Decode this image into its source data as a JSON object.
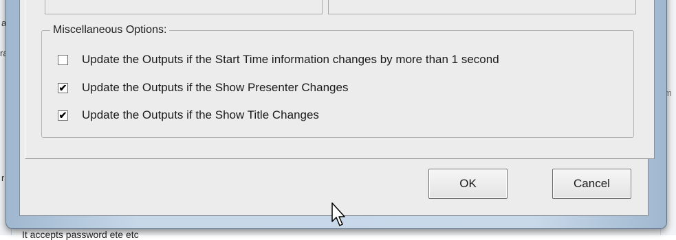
{
  "dialog": {
    "group_title": "Miscellaneous Options:",
    "options": [
      {
        "label": "Update the Outputs if the Start Time information changes by more than 1 second",
        "checked": false,
        "mark": ""
      },
      {
        "label": "Update the Outputs if the Show Presenter Changes",
        "checked": true,
        "mark": "✔"
      },
      {
        "label": "Update the Outputs if the Show Title Changes",
        "checked": true,
        "mark": "✔"
      }
    ],
    "ok_label": "OK",
    "cancel_label": "Cancel"
  },
  "background": {
    "bottom_text": "It accepts password ete etc",
    "frag_1": "a",
    "frag_2": "ra",
    "frag_3": "r",
    "frag_right": "m"
  },
  "icons": {
    "cursor": "arrow-cursor-icon",
    "checkmark": "checkmark-icon"
  }
}
